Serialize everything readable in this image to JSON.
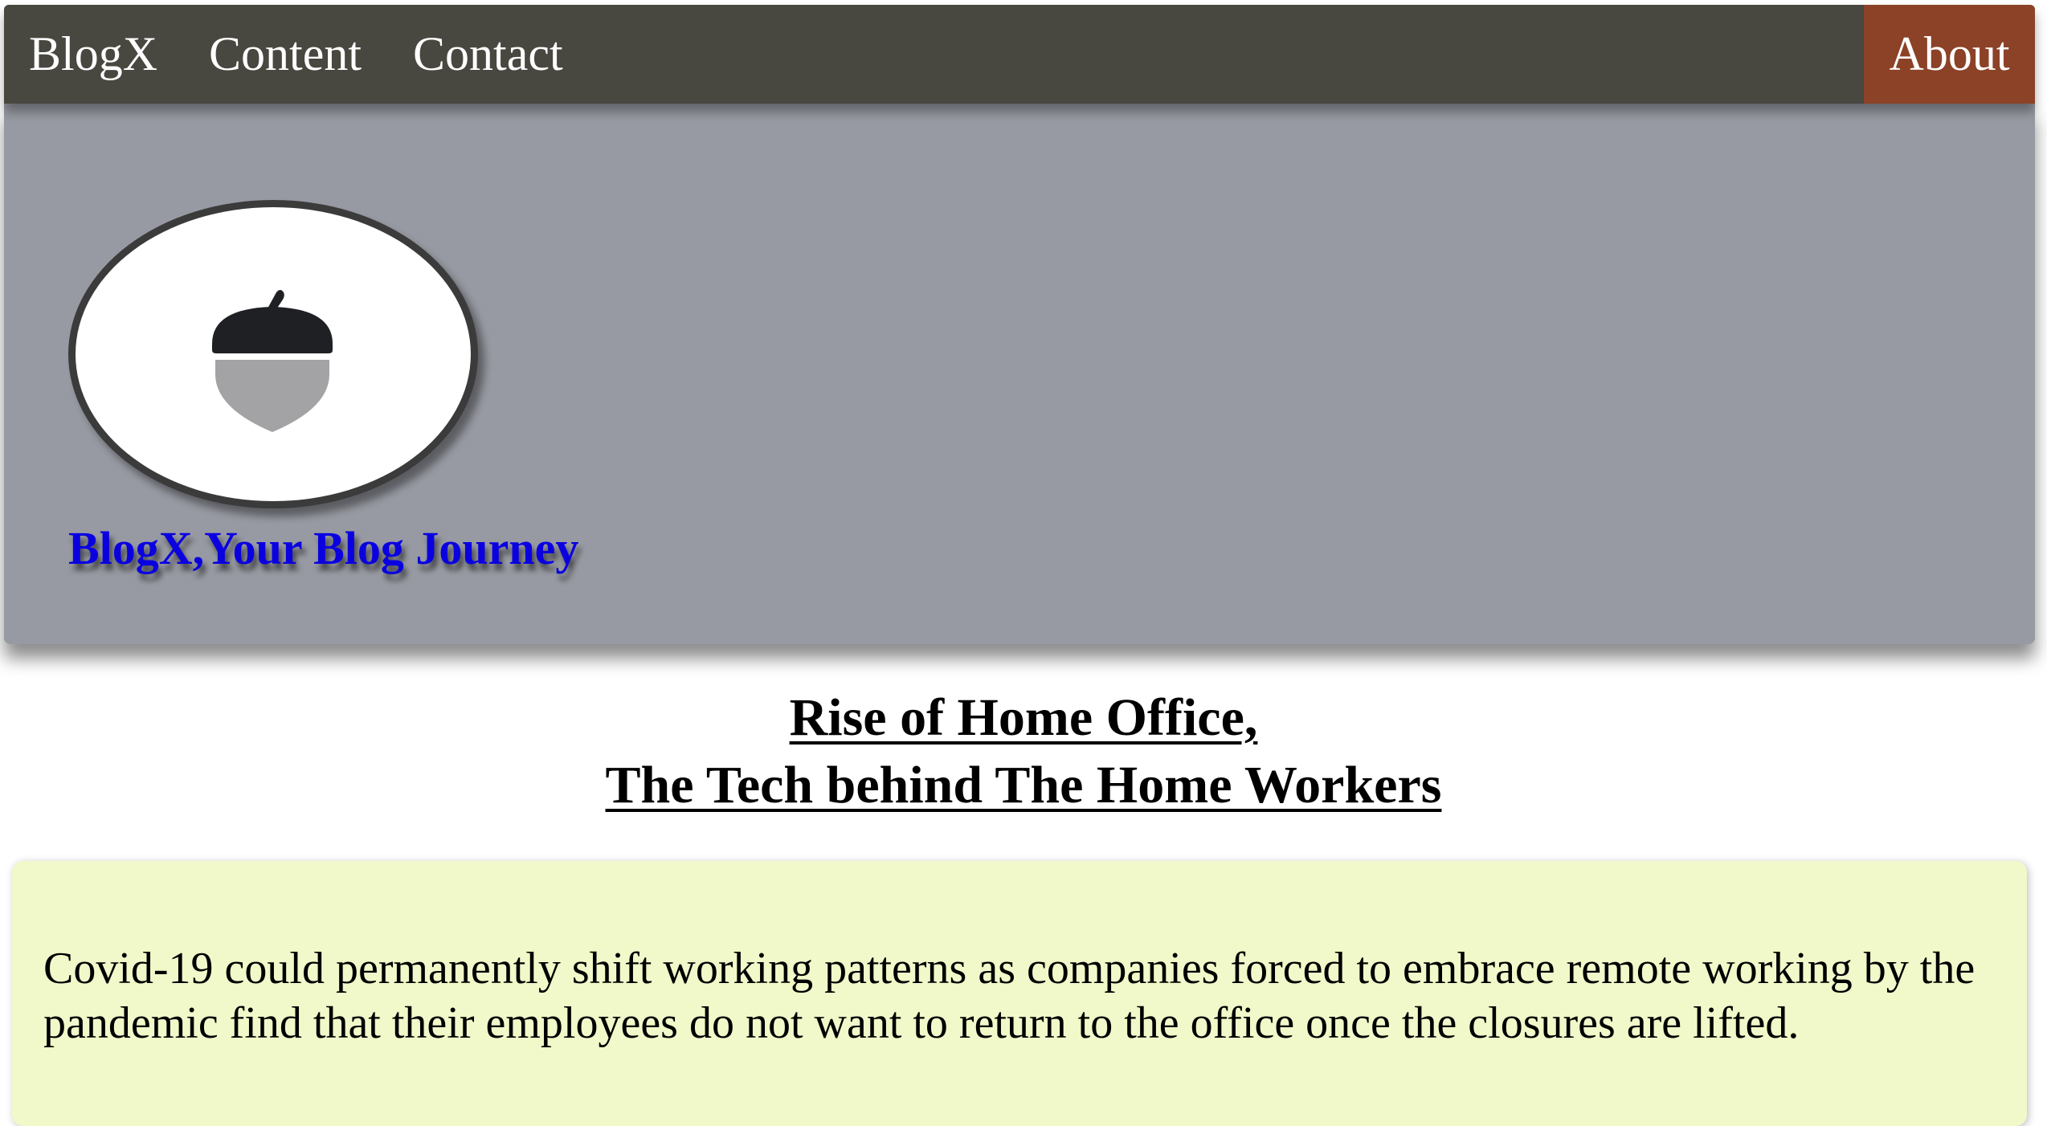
{
  "nav": {
    "brand": "BlogX",
    "items": [
      "Content",
      "Contact"
    ],
    "about": "About"
  },
  "hero": {
    "logo_icon": "acorn-icon",
    "tagline": "BlogX,Your Blog Journey"
  },
  "article": {
    "title_line1": "Rise of Home Office,",
    "title_line2": "The Tech behind The Home Workers",
    "body": "Covid-19 could permanently shift working patterns as companies forced to embrace remote working by the pandemic find that their employees do not want to return to the office once the closures are lifted."
  },
  "colors": {
    "navbar": "#484740",
    "about_button": "#8b4227",
    "hero_background": "#979aa2",
    "tagline": "#0a00e0",
    "content_background": "#f1f8c9"
  }
}
